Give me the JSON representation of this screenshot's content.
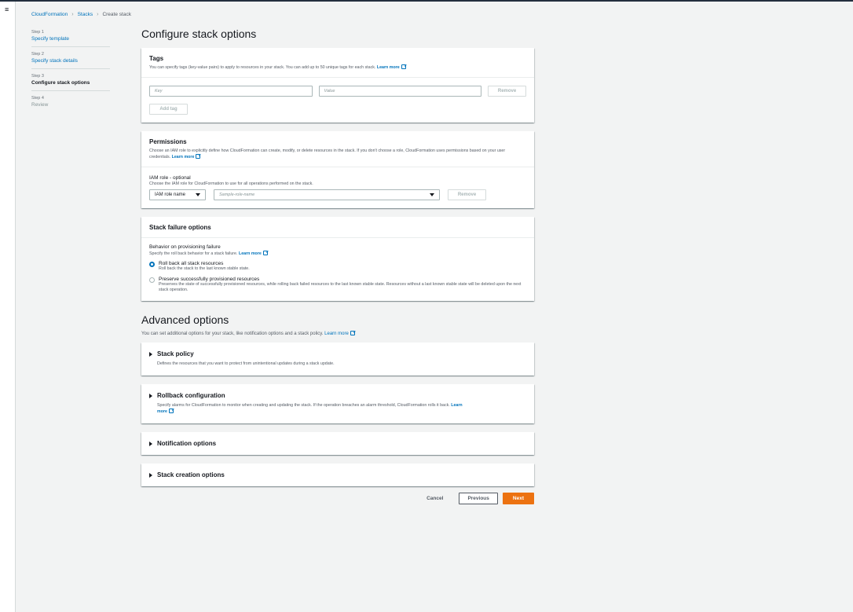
{
  "breadcrumb": {
    "cloudformation": "CloudFormation",
    "stacks": "Stacks",
    "current": "Create stack"
  },
  "steps": [
    {
      "num": "Step 1",
      "label": "Specify template"
    },
    {
      "num": "Step 2",
      "label": "Specify stack details"
    },
    {
      "num": "Step 3",
      "label": "Configure stack options"
    },
    {
      "num": "Step 4",
      "label": "Review"
    }
  ],
  "page_title": "Configure stack options",
  "tags": {
    "title": "Tags",
    "desc": "You can specify tags (key-value pairs) to apply to resources in your stack. You can add up to 50 unique tags for each stack.",
    "learn_more": "Learn more",
    "key_placeholder": "Key",
    "value_placeholder": "Value",
    "remove": "Remove",
    "add_tag": "Add tag"
  },
  "permissions": {
    "title": "Permissions",
    "desc": "Choose an IAM role to explicitly define how CloudFormation can create, modify, or delete resources in the stack. If you don't choose a role, CloudFormation uses permissions based on your user credentials.",
    "learn_more": "Learn more",
    "field_label": "IAM role - optional",
    "field_desc": "Choose the IAM role for CloudFormation to use for all operations performed on the stack.",
    "type_select": "IAM role name",
    "role_placeholder": "Sample-role-name",
    "remove": "Remove"
  },
  "failure": {
    "title": "Stack failure options",
    "field_label": "Behavior on provisioning failure",
    "field_desc": "Specify the roll back behavior for a stack failure.",
    "learn_more": "Learn more",
    "opt1_title": "Roll back all stack resources",
    "opt1_desc": "Roll back the stack to the last known stable state.",
    "opt2_title": "Preserve successfully provisioned resources",
    "opt2_desc": "Preserves the state of successfully provisioned resources, while rolling back failed resources to the last known stable state. Resources without a last known stable state will be deleted upon the next stack operation."
  },
  "advanced": {
    "title": "Advanced options",
    "desc": "You can set additional options for your stack, like notification options and a stack policy.",
    "learn_more": "Learn more",
    "stack_policy": {
      "title": "Stack policy",
      "desc": "Defines the resources that you want to protect from unintentional updates during a stack update."
    },
    "rollback": {
      "title": "Rollback configuration",
      "desc": "Specify alarms for CloudFormation to monitor when creating and updating the stack. If the operation breaches an alarm threshold, CloudFormation rolls it back.",
      "learn_more_1": "Learn",
      "learn_more_2": "more"
    },
    "notification": {
      "title": "Notification options"
    },
    "creation": {
      "title": "Stack creation options"
    }
  },
  "footer": {
    "cancel": "Cancel",
    "previous": "Previous",
    "next": "Next"
  },
  "icons": {
    "menu": "hamburger-icon",
    "external": "external-link-icon",
    "caret": "caret-down-icon",
    "expand": "caret-right-icon"
  },
  "colors": {
    "link": "#0073bb",
    "primary": "#ec7211",
    "topbar": "#232f3e"
  }
}
